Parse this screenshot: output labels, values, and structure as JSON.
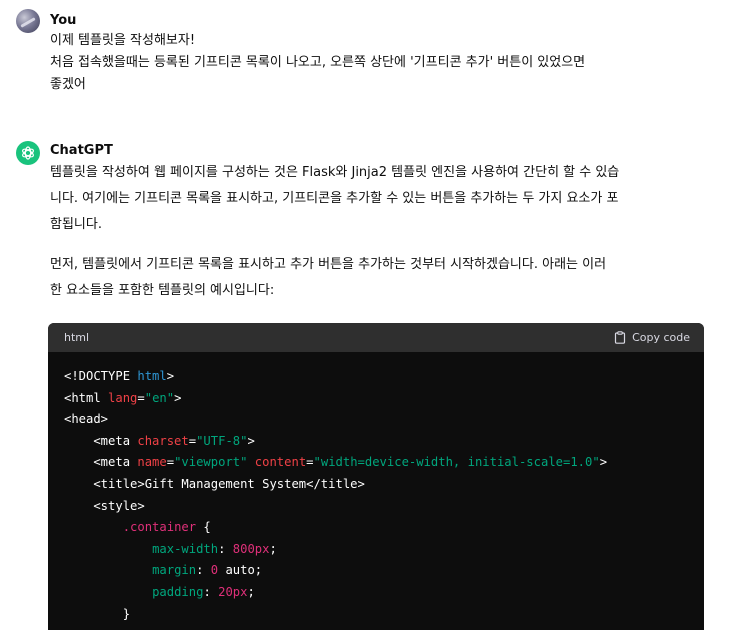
{
  "user_message": {
    "author": "You",
    "lines": [
      "이제 템플릿을 작성해보자!",
      "처음 접속했을때는 등록된 기프티콘 목록이 나오고, 오른쪽 상단에 '기프티콘 추가' 버튼이 있었으면",
      "좋겠어"
    ]
  },
  "assistant_message": {
    "author": "ChatGPT",
    "paragraph1": [
      "템플릿을 작성하여 웹 페이지를 구성하는 것은 Flask와 Jinja2 템플릿 엔진을 사용하여 간단히 할 수 있습",
      "니다. 여기에는 기프티콘 목록을 표시하고, 기프티콘을 추가할 수 있는 버튼을 추가하는 두 가지 요소가 포",
      "함됩니다."
    ],
    "paragraph2": [
      "먼저, 템플릿에서 기프티콘 목록을 표시하고 추가 버튼을 추가하는 것부터 시작하겠습니다. 아래는 이러",
      "한 요소들을 포함한 템플릿의 예시입니다:"
    ]
  },
  "code_block": {
    "language": "html",
    "copy_label": "Copy code",
    "lines": [
      "<!DOCTYPE html>",
      "<html lang=\"en\">",
      "<head>",
      "    <meta charset=\"UTF-8\">",
      "    <meta name=\"viewport\" content=\"width=device-width, initial-scale=1.0\">",
      "    <title>Gift Management System</title>",
      "    <style>",
      "        .container {",
      "            max-width: 800px;",
      "            margin: 0 auto;",
      "            padding: 20px;",
      "        }"
    ]
  }
}
